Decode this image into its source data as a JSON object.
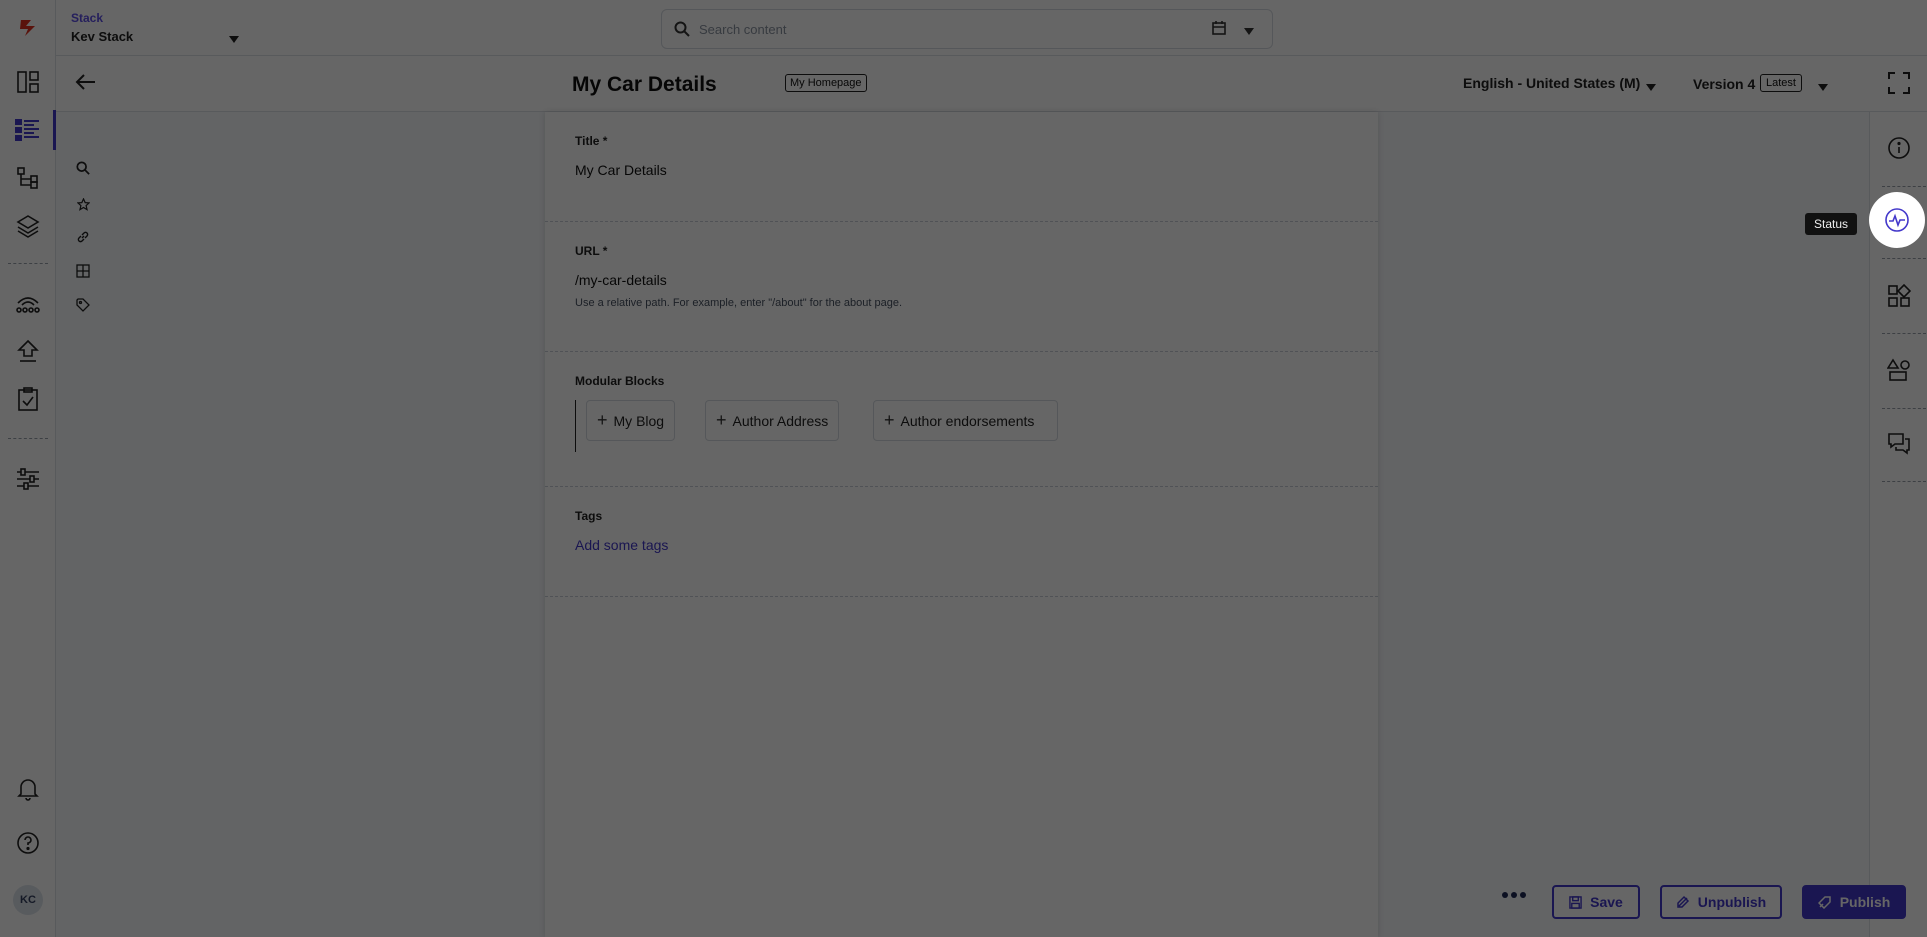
{
  "topbar": {
    "stack_label": "Stack",
    "stack_name": "Kev Stack",
    "search_placeholder": "Search content"
  },
  "header": {
    "entry_title": "My Car Details",
    "content_type_badge": "My Homepage",
    "locale": "English - United States (M)",
    "version": "Version 4",
    "version_badge": "Latest"
  },
  "fields": {
    "title": {
      "label": "Title *",
      "value": "My Car Details"
    },
    "url": {
      "label": "URL *",
      "value": "/my-car-details",
      "help": "Use a relative path. For example, enter \"/about\" for the about page."
    },
    "modular_blocks": {
      "label": "Modular Blocks",
      "blocks": [
        "My Blog",
        "Author Address",
        "Author endorsements"
      ]
    },
    "tags": {
      "label": "Tags",
      "placeholder": "Add some tags"
    }
  },
  "rail": {
    "avatar_initials": "KC"
  },
  "tooltip": {
    "status": "Status"
  },
  "footer": {
    "save": "Save",
    "unpublish": "Unpublish",
    "publish": "Publish"
  },
  "colors": {
    "accent": "#4338ca",
    "brand_logo": "#e0301e",
    "overlay": "rgba(0,0,0,0.6)"
  }
}
